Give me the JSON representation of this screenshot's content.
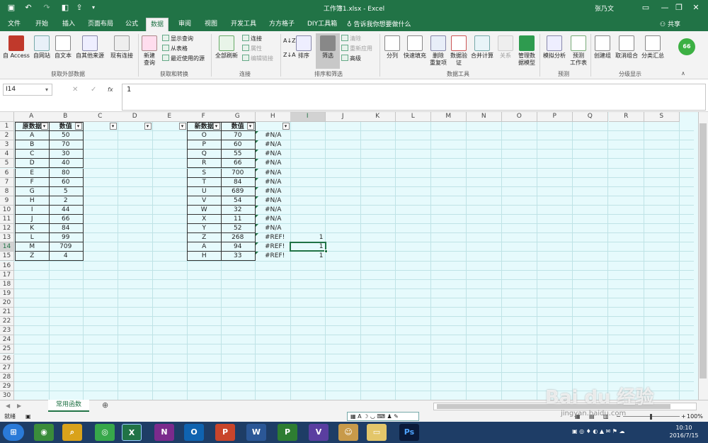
{
  "window": {
    "title": "工作簿1.xlsx - Excel",
    "user": "张乃文"
  },
  "tabs": [
    "文件",
    "开始",
    "插入",
    "页面布局",
    "公式",
    "数据",
    "审阅",
    "视图",
    "开发工具",
    "方方格子",
    "DIY工具箱"
  ],
  "active_tab": "数据",
  "tell_me": "告诉我你想要做什么",
  "share": "共享",
  "ribbon": {
    "get_external": {
      "label": "获取外部数据",
      "items": [
        "自 Access",
        "自网站",
        "自文本",
        "自其他来源",
        "现有连接"
      ]
    },
    "get_transform": {
      "label": "获取和转换",
      "new_query": "新建\n查询",
      "small": [
        "显示查询",
        "从表格",
        "最近使用的源"
      ]
    },
    "connections": {
      "label": "连接",
      "refresh": "全部刷新",
      "small": [
        "连接",
        "属性",
        "编辑链接"
      ]
    },
    "sort_filter": {
      "label": "排序和筛选",
      "sort": "排序",
      "filter": "筛选",
      "small": [
        "清除",
        "重新应用",
        "高级"
      ]
    },
    "data_tools": {
      "label": "数据工具",
      "items": [
        "分列",
        "快速填充",
        "删除\n重复项",
        "数据验\n证",
        "合并计算",
        "关系",
        "管理数\n据模型"
      ]
    },
    "forecast": {
      "label": "预测",
      "items": [
        "模拟分析",
        "预测\n工作表"
      ]
    },
    "outline": {
      "label": "分级显示",
      "items": [
        "创建组",
        "取消组合",
        "分类汇总"
      ]
    }
  },
  "formula_bar": {
    "name_box": "I14",
    "content": "1"
  },
  "columns": [
    "A",
    "B",
    "C",
    "D",
    "E",
    "F",
    "G",
    "H",
    "I",
    "J",
    "K",
    "L",
    "M",
    "N",
    "O",
    "P",
    "Q",
    "R",
    "S"
  ],
  "selected_cell": {
    "col": "I",
    "row": 14
  },
  "table1": {
    "headers": [
      "原数据",
      "数值"
    ],
    "rows": [
      [
        "A",
        "50"
      ],
      [
        "B",
        "70"
      ],
      [
        "C",
        "30"
      ],
      [
        "D",
        "40"
      ],
      [
        "E",
        "80"
      ],
      [
        "F",
        "60"
      ],
      [
        "G",
        "5"
      ],
      [
        "H",
        "2"
      ],
      [
        "I",
        "44"
      ],
      [
        "J",
        "66"
      ],
      [
        "K",
        "84"
      ],
      [
        "L",
        "99"
      ],
      [
        "M",
        "709"
      ],
      [
        "Z",
        "4"
      ]
    ]
  },
  "table2": {
    "headers": [
      "新数据",
      "数值",
      ""
    ],
    "rows": [
      [
        "O",
        "70",
        "#N/A"
      ],
      [
        "P",
        "60",
        "#N/A"
      ],
      [
        "Q",
        "55",
        "#N/A"
      ],
      [
        "R",
        "66",
        "#N/A"
      ],
      [
        "S",
        "700",
        "#N/A"
      ],
      [
        "T",
        "84",
        "#N/A"
      ],
      [
        "U",
        "689",
        "#N/A"
      ],
      [
        "V",
        "54",
        "#N/A"
      ],
      [
        "W",
        "32",
        "#N/A"
      ],
      [
        "X",
        "11",
        "#N/A"
      ],
      [
        "Y",
        "52",
        "#N/A"
      ],
      [
        "Z",
        "268",
        "#REF!"
      ],
      [
        "A",
        "94",
        "#REF!"
      ],
      [
        "H",
        "33",
        "#REF!"
      ]
    ]
  },
  "col_i_values": [
    {
      "row": 13,
      "value": "1"
    },
    {
      "row": 14,
      "value": "1"
    },
    {
      "row": 15,
      "value": "1"
    }
  ],
  "sheet_tab": "常用函数",
  "status": {
    "ready": "就绪",
    "zoom": "100%"
  },
  "taskbar": {
    "time": "10:10",
    "date": "2016/7/15"
  },
  "watermark": {
    "brand": "Bai du 经验",
    "url": "jingyan.baidu.com"
  }
}
